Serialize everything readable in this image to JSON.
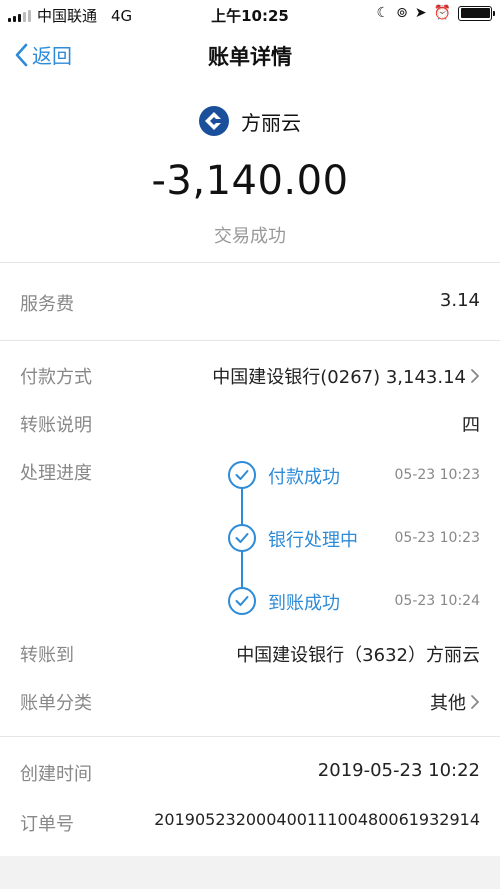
{
  "status_bar": {
    "carrier": "中国联通",
    "network": "4G",
    "time": "上午10:25"
  },
  "nav": {
    "back_label": "返回",
    "title": "账单详情"
  },
  "header": {
    "payee": "方丽云",
    "amount": "-3,140.00",
    "status": "交易成功"
  },
  "fee": {
    "label": "服务费",
    "value": "3.14"
  },
  "payment_method": {
    "label": "付款方式",
    "value": "中国建设银行(0267) 3,143.14"
  },
  "remark": {
    "label": "转账说明",
    "value": "四"
  },
  "progress": {
    "label": "处理进度",
    "steps": [
      {
        "label": "付款成功",
        "time": "05-23 10:23"
      },
      {
        "label": "银行处理中",
        "time": "05-23 10:23"
      },
      {
        "label": "到账成功",
        "time": "05-23 10:24"
      }
    ]
  },
  "transfer_to": {
    "label": "转账到",
    "value": "中国建设银行（3632）方丽云"
  },
  "category": {
    "label": "账单分类",
    "value": "其他"
  },
  "created": {
    "label": "创建时间",
    "value": "2019-05-23 10:22"
  },
  "order": {
    "label": "订单号",
    "value": "20190523200040011100480061932914"
  },
  "colors": {
    "accent": "#2e8bd8",
    "label": "#888888",
    "bank_logo": "#1a4f9c"
  }
}
